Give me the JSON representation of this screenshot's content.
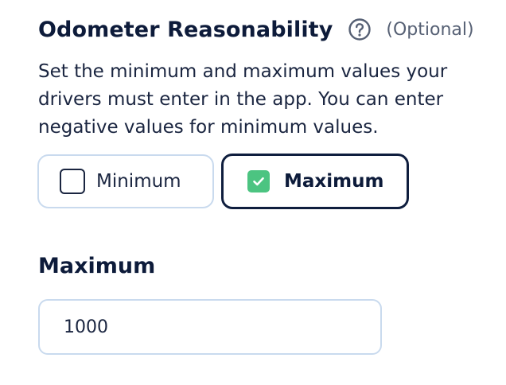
{
  "section": {
    "title": "Odometer Reasonability",
    "optional_label": "(Optional)",
    "help_icon": "question-circle-icon",
    "description": "Set the minimum and maximum values your drivers must enter in the app. You can enter negative values for minimum values."
  },
  "toggles": [
    {
      "label": "Minimum",
      "checked": false
    },
    {
      "label": "Maximum",
      "checked": true
    }
  ],
  "maximum_field": {
    "label": "Maximum",
    "value": "1000"
  },
  "colors": {
    "text_primary": "#0d1b3a",
    "muted": "#566074",
    "border_light": "#c9daee",
    "border_active": "#0f1e3e",
    "check_green": "#4cc481"
  }
}
